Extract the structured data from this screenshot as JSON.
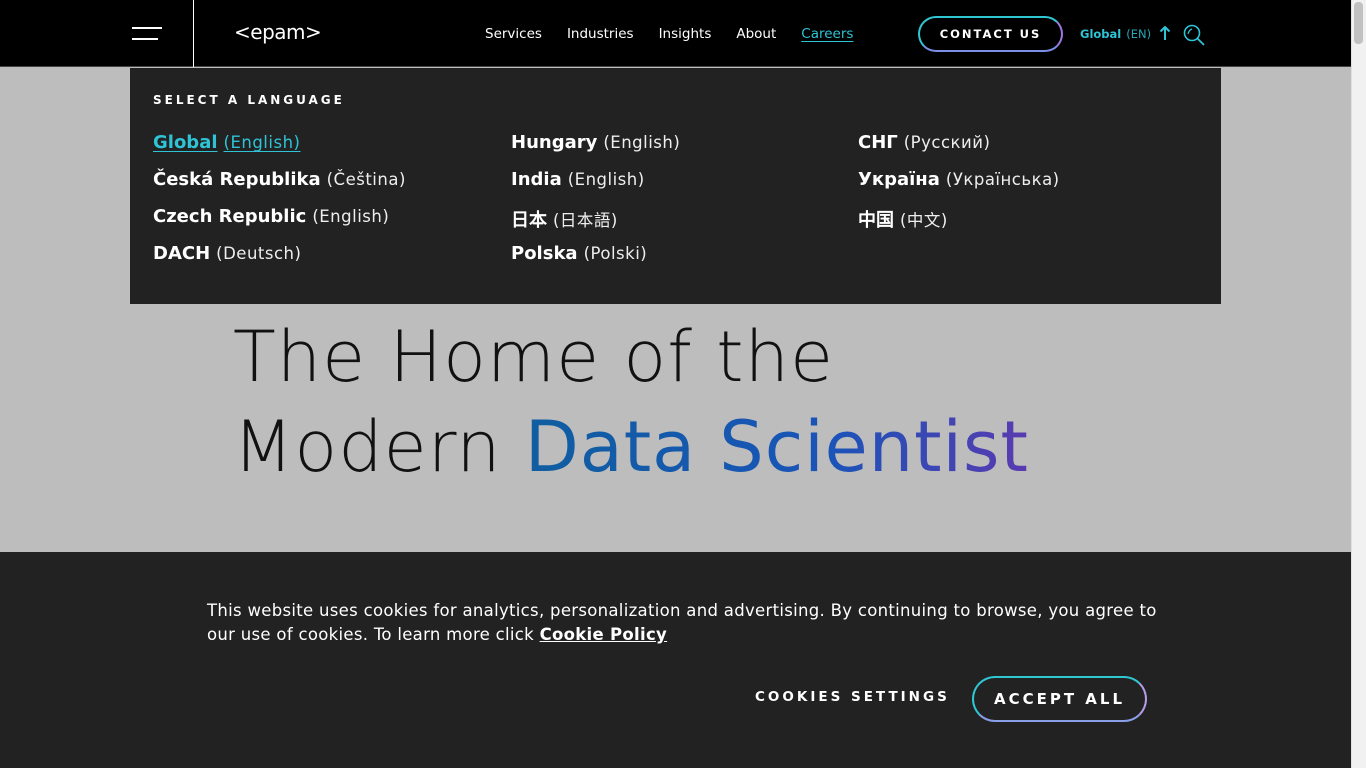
{
  "header": {
    "logo": "<epam>",
    "nav": [
      "Services",
      "Industries",
      "Insights",
      "About",
      "Careers"
    ],
    "contact_label": "CONTACT US",
    "lang_name": "Global",
    "lang_code": "(EN)",
    "accent_color": "#2ec4d6"
  },
  "language_panel": {
    "title": "SELECT A LANGUAGE",
    "columns": [
      [
        {
          "country": "Global",
          "language": "(English)"
        },
        {
          "country": "Česká Republika",
          "language": "(Čeština)"
        },
        {
          "country": "Czech Republic",
          "language": "(English)"
        },
        {
          "country": "DACH",
          "language": "(Deutsch)"
        }
      ],
      [
        {
          "country": "Hungary",
          "language": "(English)"
        },
        {
          "country": "India",
          "language": "(English)"
        },
        {
          "country": "日本",
          "language": "(日本語)"
        },
        {
          "country": "Polska",
          "language": "(Polski)"
        }
      ],
      [
        {
          "country": "СНГ",
          "language": "(Русский)"
        },
        {
          "country": "Україна",
          "language": "(Українська)"
        },
        {
          "country": "中国",
          "language": "(中文)"
        }
      ]
    ]
  },
  "hero": {
    "line1": "The Home of the",
    "line2_plain": "Modern ",
    "line2_accent": "Data Scientist"
  },
  "cookie": {
    "text": "This website uses cookies for analytics, personalization and advertising. By continuing to browse, you agree to our use of cookies. To learn more click ",
    "link": "Cookie Policy",
    "settings_label": "COOKIES SETTINGS",
    "accept_label": "ACCEPT ALL"
  }
}
